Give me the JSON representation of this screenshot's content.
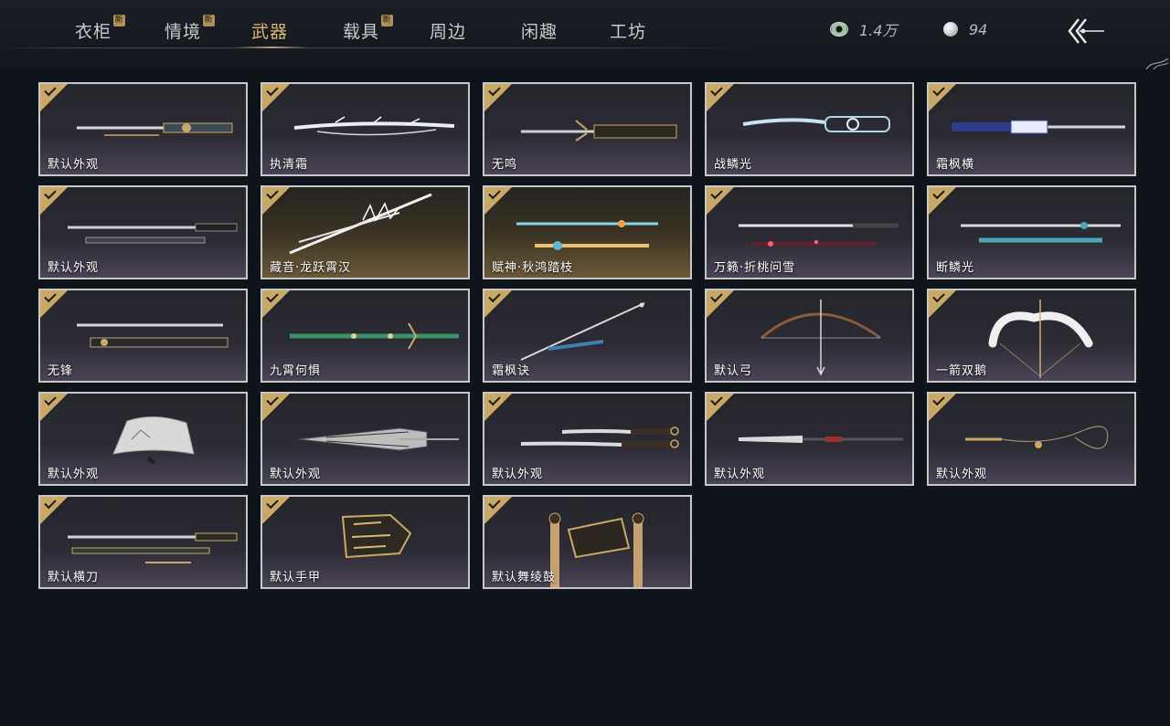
{
  "nav": {
    "tabs": [
      {
        "label": "衣柜",
        "new": true,
        "badge": "新"
      },
      {
        "label": "情境",
        "new": true,
        "badge": "新"
      },
      {
        "label": "武器",
        "active": true
      },
      {
        "label": "载具",
        "new": true,
        "badge": "新"
      },
      {
        "label": "周边"
      },
      {
        "label": "闲趣"
      },
      {
        "label": "工坊"
      }
    ]
  },
  "currency": {
    "jade": {
      "icon": "jade-coin-icon",
      "value": "1.4万"
    },
    "pearl": {
      "icon": "pearl-icon",
      "value": "94"
    }
  },
  "back": {
    "icon": "back-arrow-icon"
  },
  "colors": {
    "accent": "#d7b677",
    "check": "#c9a866",
    "card_border": "#c7c7c7",
    "background": "#0f131a"
  },
  "items": [
    {
      "name": "默认外观",
      "owned": true,
      "icon": "sword-icon"
    },
    {
      "name": "执清霜",
      "owned": true,
      "icon": "frost-sword-icon"
    },
    {
      "name": "无鸣",
      "owned": true,
      "icon": "sword-icon"
    },
    {
      "name": "战鳞光",
      "owned": true,
      "icon": "dragon-sword-icon"
    },
    {
      "name": "霜枫横",
      "owned": true,
      "icon": "sword-icon"
    },
    {
      "name": "默认外观",
      "owned": true,
      "icon": "twin-blade-icon"
    },
    {
      "name": "藏音·龙跃霄汉",
      "owned": true,
      "icon": "crystal-blade-icon",
      "gold": true
    },
    {
      "name": "赋神·秋鸿踏枝",
      "owned": true,
      "icon": "twin-blade-icon",
      "gold": true
    },
    {
      "name": "万籁·折桃问雪",
      "owned": true,
      "icon": "twin-blade-icon"
    },
    {
      "name": "断鳞光",
      "owned": true,
      "icon": "twin-blade-icon"
    },
    {
      "name": "无锋",
      "owned": true,
      "icon": "twin-blade-icon"
    },
    {
      "name": "九霄何惧",
      "owned": true,
      "icon": "jade-spear-icon"
    },
    {
      "name": "霜枫诀",
      "owned": true,
      "icon": "spear-icon"
    },
    {
      "name": "默认弓",
      "owned": true,
      "icon": "bow-icon"
    },
    {
      "name": "一箭双鹅",
      "owned": true,
      "icon": "swan-bow-icon"
    },
    {
      "name": "默认外观",
      "owned": true,
      "icon": "fan-icon"
    },
    {
      "name": "默认外观",
      "owned": true,
      "icon": "umbrella-icon"
    },
    {
      "name": "默认外观",
      "owned": true,
      "icon": "dual-saber-icon"
    },
    {
      "name": "默认外观",
      "owned": true,
      "icon": "glaive-icon"
    },
    {
      "name": "默认外观",
      "owned": true,
      "icon": "rope-dart-icon"
    },
    {
      "name": "默认横刀",
      "owned": true,
      "icon": "hengdao-icon"
    },
    {
      "name": "默认手甲",
      "owned": true,
      "icon": "gauntlet-icon"
    },
    {
      "name": "默认舞绫鼓",
      "owned": true,
      "icon": "drum-icon"
    }
  ]
}
